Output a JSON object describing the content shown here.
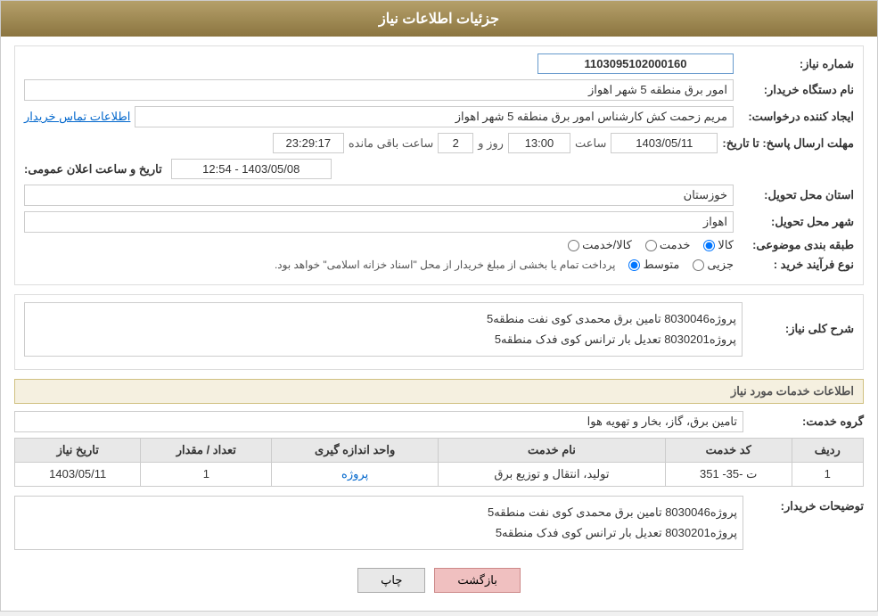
{
  "header": {
    "title": "جزئیات اطلاعات نیاز"
  },
  "fields": {
    "need_number_label": "شماره نیاز:",
    "need_number_value": "1103095102000160",
    "buyer_station_label": "نام دستگاه خریدار:",
    "buyer_station_value": "امور برق منطقه 5 شهر اهواز",
    "requester_label": "ایجاد کننده درخواست:",
    "requester_value": "مریم زحمت کش کارشناس امور برق منطقه 5 شهر اهواز",
    "contact_link": "اطلاعات تماس خریدار",
    "reply_deadline_label": "مهلت ارسال پاسخ: تا تاریخ:",
    "reply_date_value": "1403/05/11",
    "reply_time_label": "ساعت",
    "reply_time_value": "13:00",
    "reply_days_label": "روز و",
    "reply_days_value": "2",
    "reply_remaining_label": "ساعت باقی مانده",
    "reply_remaining_value": "23:29:17",
    "public_announce_label": "تاریخ و ساعت اعلان عمومی:",
    "public_announce_value": "1403/05/08 - 12:54",
    "province_label": "استان محل تحویل:",
    "province_value": "خوزستان",
    "city_label": "شهر محل تحویل:",
    "city_value": "اهواز",
    "category_label": "طبقه بندی موضوعی:",
    "category_goods": "کالا",
    "category_service": "خدمت",
    "category_goods_service": "کالا/خدمت",
    "purchase_type_label": "نوع فرآیند خرید :",
    "purchase_type_partial": "جزیی",
    "purchase_type_medium": "متوسط",
    "purchase_type_note": "پرداخت تمام یا بخشی از مبلغ خریدار از محل \"اسناد خزانه اسلامی\" خواهد بود."
  },
  "need_description": {
    "section_title": "شرح کلی نیاز:",
    "line1": "پروژه8030046 تامین برق محمدی کوی نفت منطقه5",
    "line2": "پروژه8030201 تعدیل بار ترانس کوی فدک منطقه5"
  },
  "services_info": {
    "section_title": "اطلاعات خدمات مورد نیاز",
    "group_label": "گروه خدمت:",
    "group_value": "تامین برق، گاز، بخار و تهویه هوا",
    "table": {
      "headers": [
        "ردیف",
        "کد خدمت",
        "نام خدمت",
        "واحد اندازه گیری",
        "تعداد / مقدار",
        "تاریخ نیاز"
      ],
      "rows": [
        {
          "row_num": "1",
          "service_code": "ت -35- 351",
          "service_name": "تولید، انتقال و توزیع برق",
          "unit": "پروژه",
          "quantity": "1",
          "date": "1403/05/11"
        }
      ]
    }
  },
  "buyer_notes": {
    "label": "توضیحات خریدار:",
    "line1": "پروژه8030046 تامین برق محمدی کوی نفت منطقه5",
    "line2": "پروژه8030201 تعدیل بار ترانس کوی فدک منطقه5"
  },
  "buttons": {
    "print_label": "چاپ",
    "back_label": "بازگشت"
  }
}
